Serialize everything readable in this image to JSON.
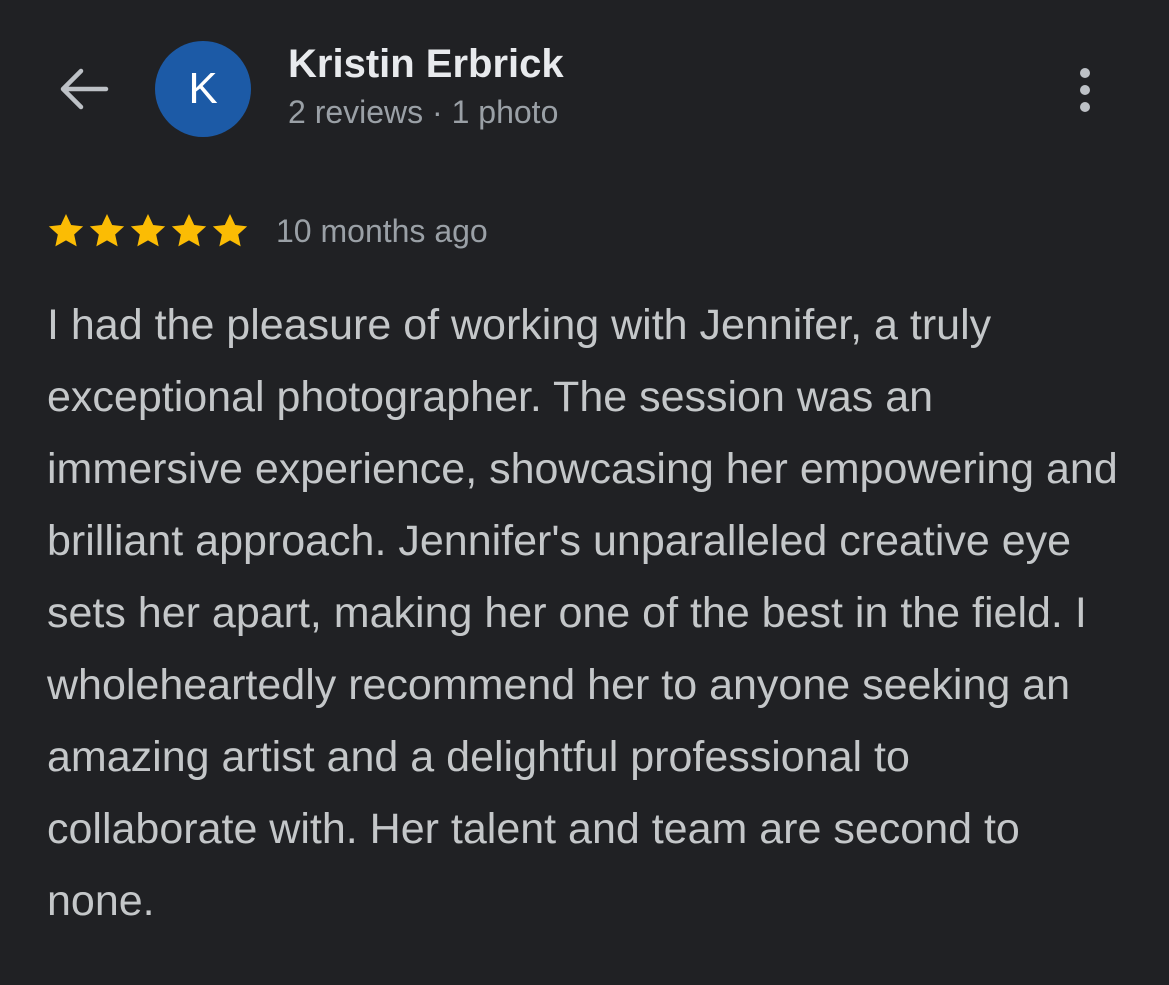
{
  "header": {
    "back_icon": "arrow-left-icon",
    "avatar_letter": "K",
    "avatar_color": "#1c5aa6",
    "user_name": "Kristin Erbrick",
    "user_meta": "2 reviews · 1 photo",
    "more_icon": "more-vertical-icon"
  },
  "review": {
    "rating": 5,
    "rating_max": 5,
    "star_color": "#fbbc04",
    "time_ago": "10 months ago",
    "text": "I had the pleasure of working with Jennifer, a truly exceptional photographer. The session was an immersive experience, showcasing her empowering and brilliant approach. Jennifer's unparalleled creative eye sets her apart, making her one of the best in the field. I wholeheartedly recommend her to anyone seeking an amazing artist and a delightful professional to collaborate with. Her talent and team are second to none."
  }
}
